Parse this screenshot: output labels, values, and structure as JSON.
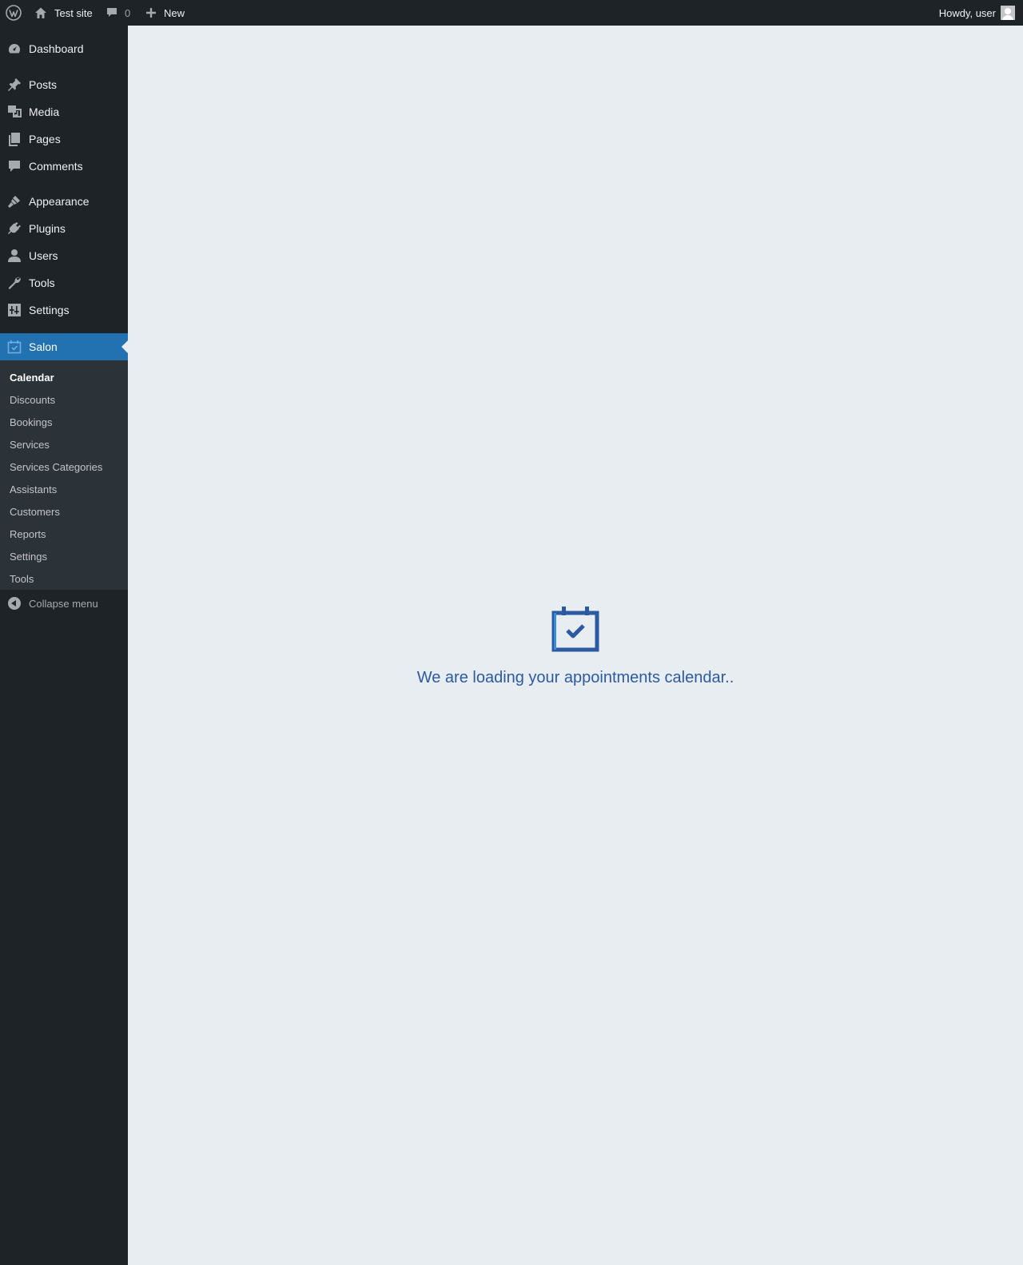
{
  "adminbar": {
    "site_name": "Test site",
    "comment_count": "0",
    "new_label": "New",
    "howdy": "Howdy, user",
    "icons": [
      "wordpress-logo-icon",
      "home-icon",
      "comment-icon",
      "plus-icon",
      "avatar"
    ]
  },
  "menu": {
    "items": [
      {
        "label": "Dashboard",
        "icon": "dashboard-icon"
      },
      {
        "label": "Posts",
        "icon": "pin-icon"
      },
      {
        "label": "Media",
        "icon": "media-icon"
      },
      {
        "label": "Pages",
        "icon": "pages-icon"
      },
      {
        "label": "Comments",
        "icon": "comment-icon"
      },
      {
        "label": "Appearance",
        "icon": "paintbrush-icon"
      },
      {
        "label": "Plugins",
        "icon": "plug-icon"
      },
      {
        "label": "Users",
        "icon": "user-icon"
      },
      {
        "label": "Tools",
        "icon": "wrench-icon"
      },
      {
        "label": "Settings",
        "icon": "settings-icon"
      },
      {
        "label": "Salon",
        "icon": "calendar-check-icon",
        "current": true
      }
    ],
    "submenu": [
      {
        "label": "Calendar",
        "active": true
      },
      {
        "label": "Discounts"
      },
      {
        "label": "Bookings"
      },
      {
        "label": "Services"
      },
      {
        "label": "Services Categories"
      },
      {
        "label": "Assistants"
      },
      {
        "label": "Customers"
      },
      {
        "label": "Reports"
      },
      {
        "label": "Settings"
      },
      {
        "label": "Tools"
      }
    ],
    "collapse_label": "Collapse menu"
  },
  "main": {
    "loading_text": "We are loading your appointments calendar..",
    "loading_icon": "calendar-check-icon"
  },
  "colors": {
    "adminbar_bg": "#1d2327",
    "menu_bg": "#1d2327",
    "submenu_bg": "#2c3338",
    "current_bg": "#2271b1",
    "content_bg": "#e8edf2",
    "loading_text": "#2c5aa0"
  }
}
